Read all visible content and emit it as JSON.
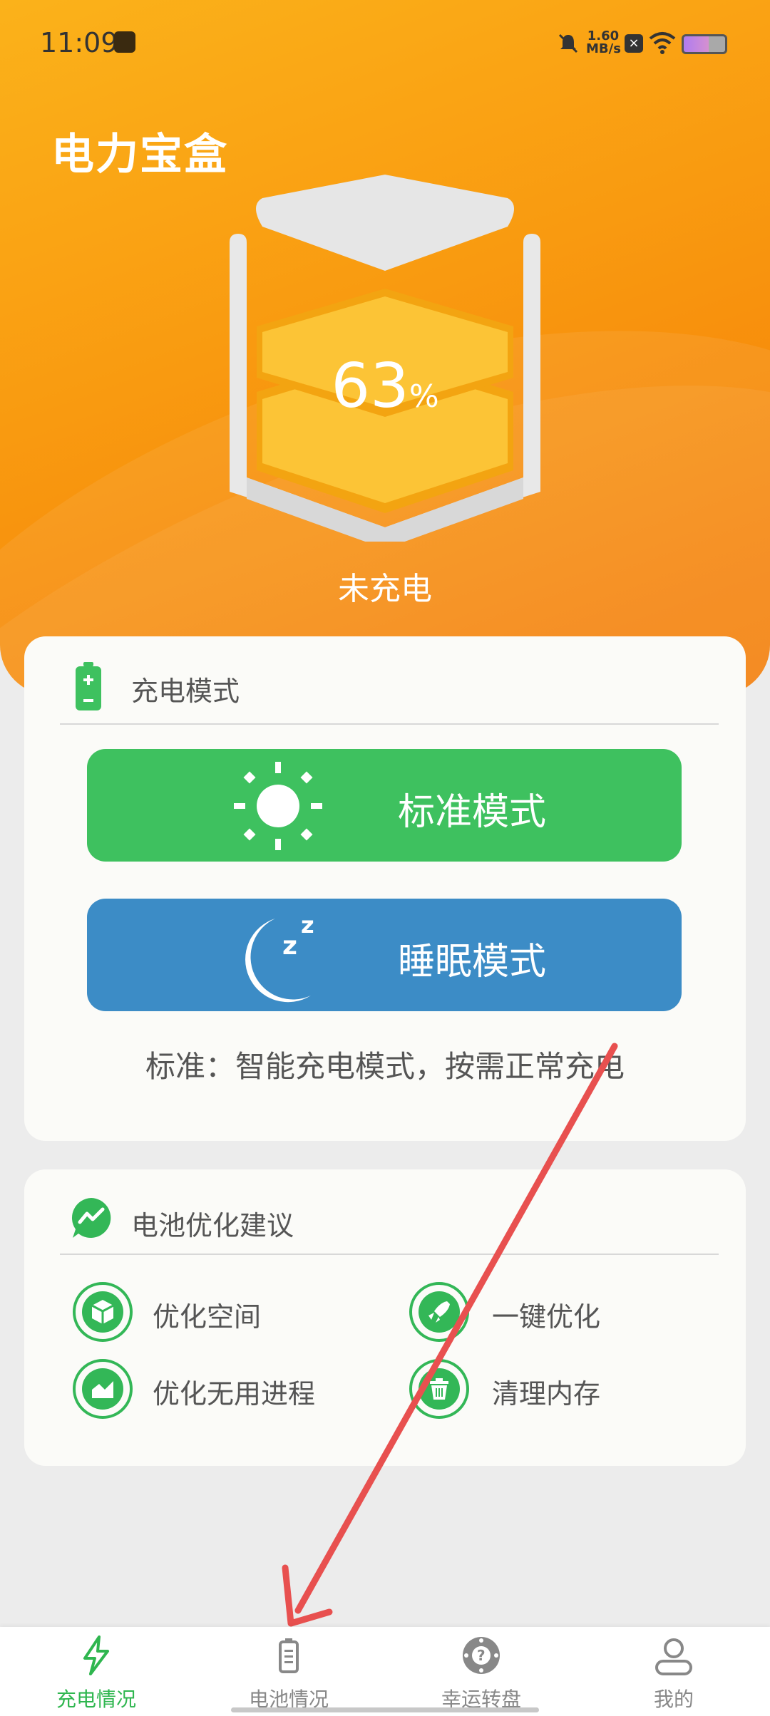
{
  "status_bar": {
    "time": "11:09",
    "net_speed_value": "1.60",
    "net_speed_unit": "MB/s"
  },
  "app": {
    "title": "电力宝盒"
  },
  "battery": {
    "level": "63",
    "unit": "%",
    "status": "未充电"
  },
  "charge_mode": {
    "header": "充电模式",
    "standard_label": "标准模式",
    "sleep_label": "睡眠模式",
    "description": "标准：智能充电模式，按需正常充电"
  },
  "optimization": {
    "header": "电池优化建议",
    "items": [
      "优化空间",
      "一键优化",
      "优化无用进程",
      "清理内存"
    ]
  },
  "nav": {
    "items": [
      "充电情况",
      "电池情况",
      "幸运转盘",
      "我的"
    ],
    "active": 0
  },
  "colors": {
    "accent_green": "#3ec15f",
    "sleep_blue": "#3c8cc6",
    "hero_orange": "#f99a10"
  }
}
